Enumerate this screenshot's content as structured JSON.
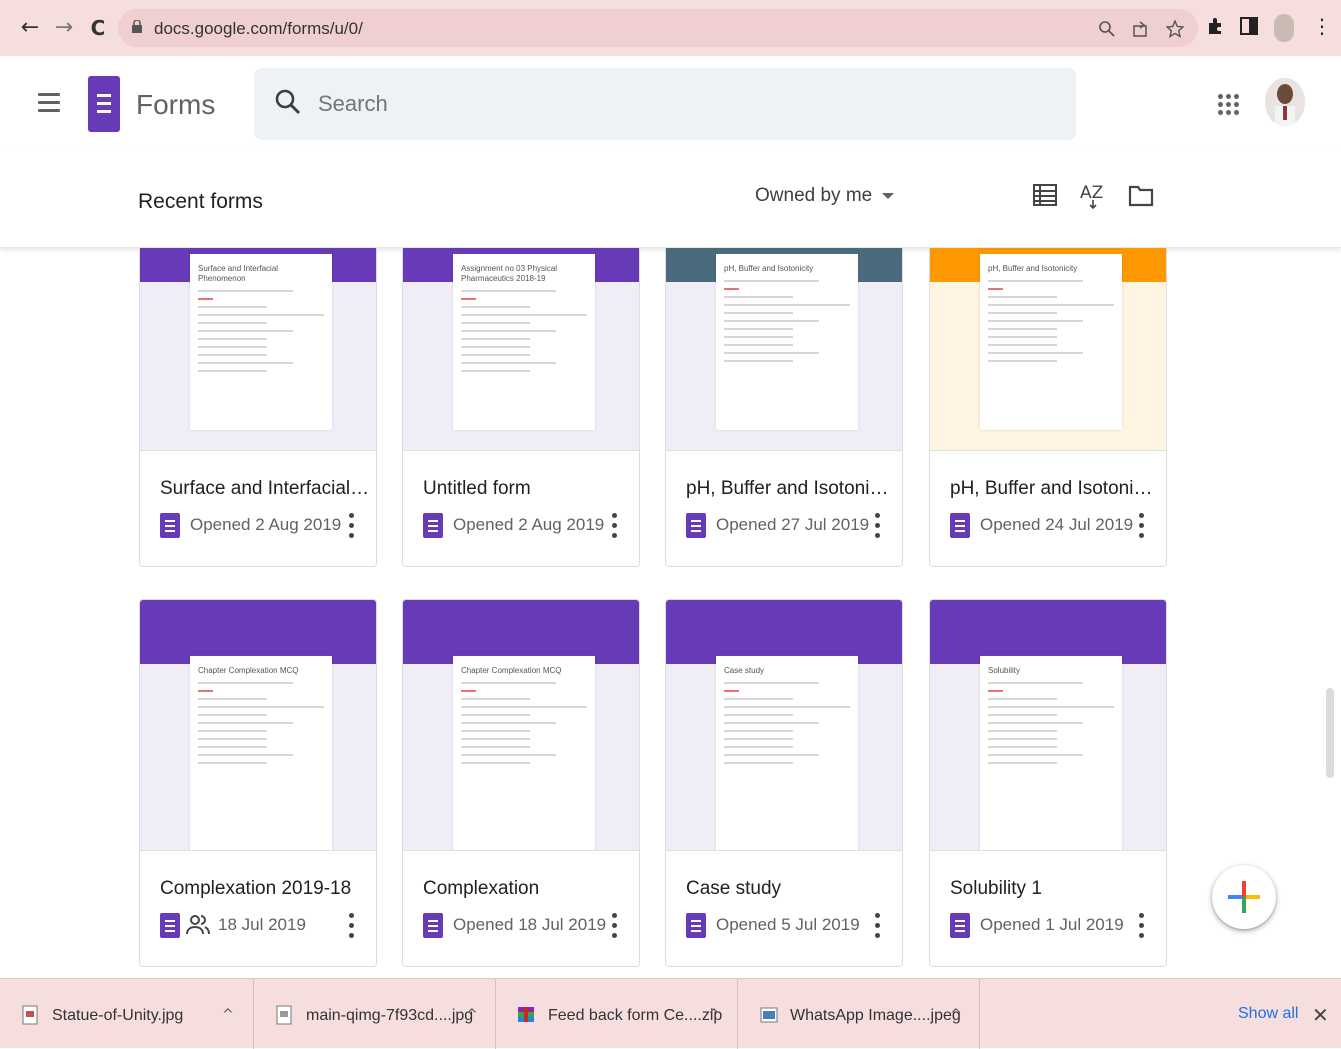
{
  "browser": {
    "url": "docs.google.com/forms/u/0/",
    "back_glyph": "←",
    "forward_glyph": "→",
    "reload_glyph": "C",
    "more_glyph": "⋮"
  },
  "app": {
    "title": "Forms",
    "search_placeholder": "Search"
  },
  "toolbar": {
    "section_title": "Recent forms",
    "owner_filter": "Owned by me"
  },
  "forms": [
    {
      "name": "Surface and Interfacial Ph...",
      "meta": "Opened 2 Aug 2019",
      "shared": false,
      "accent": "#673ab7",
      "sheet_title": "Surface and Interfacial Phenomenon"
    },
    {
      "name": "Untitled form",
      "meta": "Opened 2 Aug 2019",
      "shared": false,
      "accent": "#673ab7",
      "sheet_title": "Assignment no 03 Physical Pharmaceutics 2018-19"
    },
    {
      "name": "pH, Buffer and Isotonicity...",
      "meta": "Opened 27 Jul 2019",
      "shared": false,
      "accent": "#4a6b7c",
      "sheet_title": "pH, Buffer and Isotonicity"
    },
    {
      "name": "pH, Buffer and Isotonicity",
      "meta": "Opened 24 Jul 2019",
      "shared": false,
      "accent": "#ff9800",
      "sheet_title": "pH, Buffer and Isotonicity"
    },
    {
      "name": "Complexation 2019-18",
      "meta": "18 Jul 2019",
      "shared": true,
      "accent": "#673ab7",
      "sheet_title": "Chapter Complexation MCQ"
    },
    {
      "name": "Complexation",
      "meta": "Opened 18 Jul 2019",
      "shared": false,
      "accent": "#673ab7",
      "sheet_title": "Chapter Complexation MCQ"
    },
    {
      "name": "Case study",
      "meta": "Opened 5 Jul 2019",
      "shared": false,
      "accent": "#673ab7",
      "sheet_title": "Case study"
    },
    {
      "name": "Solubility 1",
      "meta": "Opened 1 Jul 2019",
      "shared": false,
      "accent": "#673ab7",
      "sheet_title": "Solubility"
    }
  ],
  "downloads": {
    "items": [
      {
        "name": "Statue-of-Unity.jpg"
      },
      {
        "name": "main-qimg-7f93cd....jpg"
      },
      {
        "name": "Feed back form Ce....zip"
      },
      {
        "name": "WhatsApp Image....jpeg"
      }
    ],
    "show_all": "Show all",
    "close_glyph": "✕",
    "chevron_glyph": "^"
  }
}
